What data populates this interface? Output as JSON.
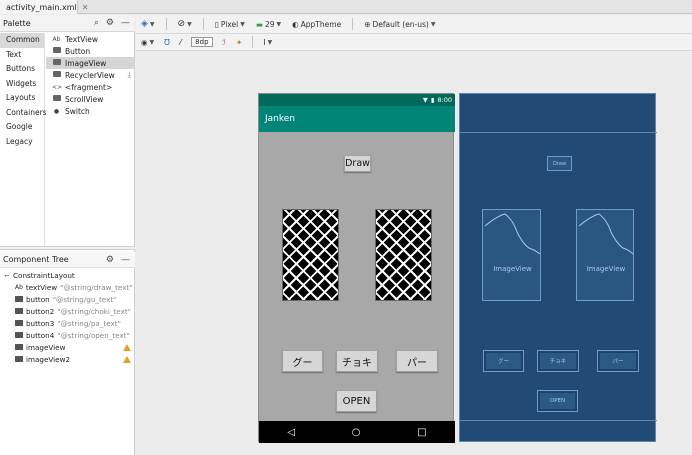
{
  "tab": {
    "filename": "activity_main.xml"
  },
  "palette": {
    "title": "Palette",
    "categories": [
      "Common",
      "Text",
      "Buttons",
      "Widgets",
      "Layouts",
      "Containers",
      "Google",
      "Legacy"
    ],
    "widgets": [
      {
        "prefix": "Ab",
        "label": "TextView"
      },
      {
        "prefix": "",
        "label": "Button"
      },
      {
        "prefix": "",
        "label": "ImageView"
      },
      {
        "prefix": "",
        "label": "RecyclerView"
      },
      {
        "prefix": "<>",
        "label": "<fragment>"
      },
      {
        "prefix": "",
        "label": "ScrollView"
      },
      {
        "prefix": "",
        "label": "Switch"
      }
    ]
  },
  "component_tree": {
    "title": "Component Tree",
    "root": "ConstraintLayout",
    "nodes": [
      {
        "prefix": "Ab",
        "name": "textView",
        "string": "\"@string/draw_text\""
      },
      {
        "prefix": "",
        "name": "button",
        "string": "\"@string/gu_text\""
      },
      {
        "prefix": "",
        "name": "button2",
        "string": "\"@string/choki_text\""
      },
      {
        "prefix": "",
        "name": "button3",
        "string": "\"@string/pa_text\""
      },
      {
        "prefix": "",
        "name": "button4",
        "string": "\"@string/open_text\""
      },
      {
        "prefix": "",
        "name": "imageView",
        "string": ""
      },
      {
        "prefix": "",
        "name": "imageView2",
        "string": ""
      }
    ]
  },
  "toolbar": {
    "device": "Pixel",
    "api": "29",
    "theme": "AppTheme",
    "locale": "Default (en-us)",
    "margin": "8dp"
  },
  "phone": {
    "status_time": "8:00",
    "app_title": "Janken",
    "draw_label": "Draw",
    "gu_label": "グー",
    "choki_label": "チョキ",
    "pa_label": "パー",
    "open_label": "OPEN",
    "nav_back": "◁",
    "nav_home": "○",
    "nav_recent": "□"
  },
  "blueprint": {
    "draw_label": "Draw",
    "image_label_1": "ImageView",
    "image_label_2": "ImageView",
    "gu_label": "グー",
    "choki_label": "チョキ",
    "pa_label": "パー",
    "open_label": "OPEN"
  },
  "colors": {
    "appbar": "#008577",
    "statusbar": "#00695c",
    "blueprint_bg": "#214a74",
    "warning": "#e8a020"
  }
}
